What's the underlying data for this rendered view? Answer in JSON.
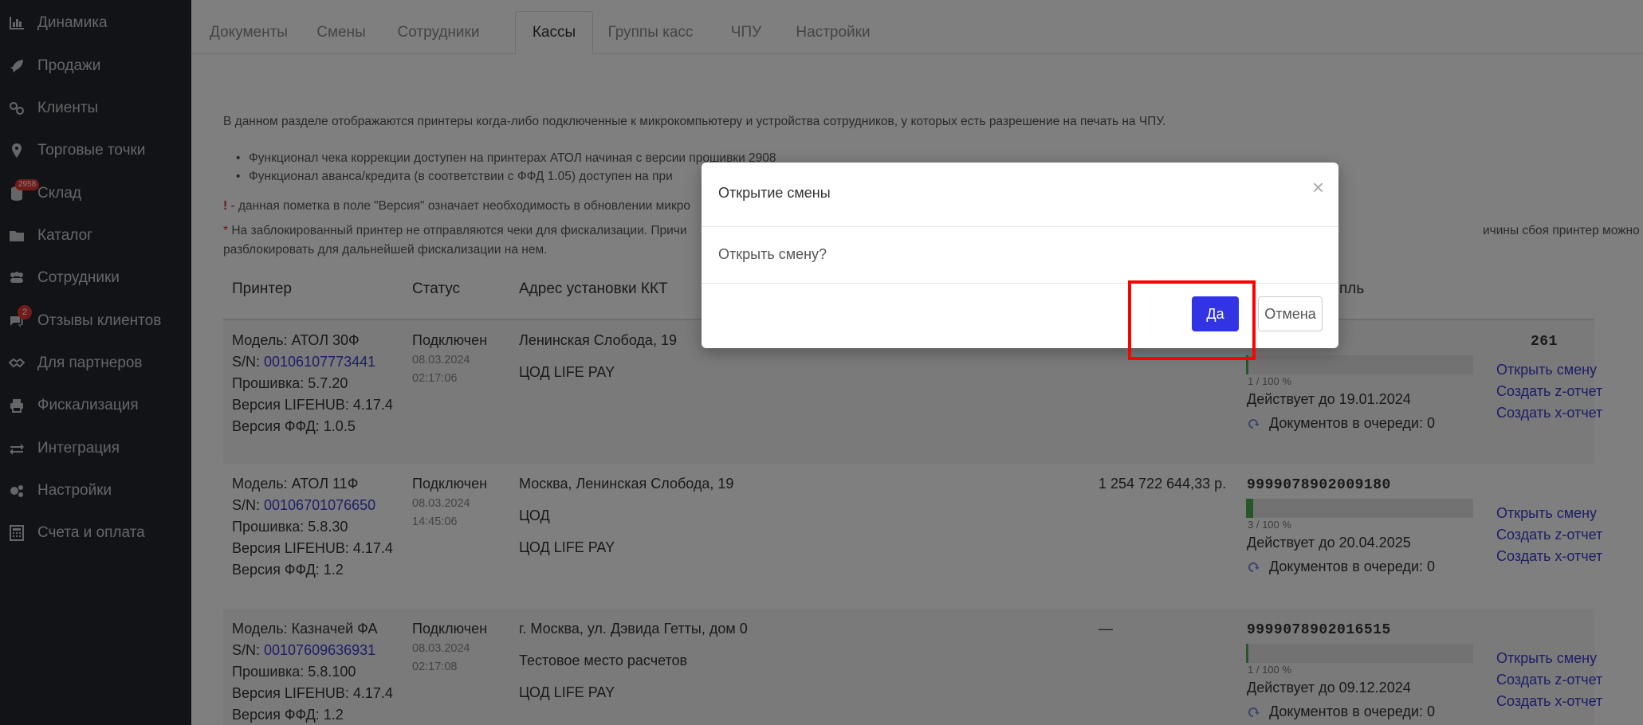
{
  "sidebar": {
    "items": [
      {
        "label": "Динамика",
        "icon": "bar-chart-icon"
      },
      {
        "label": "Продажи",
        "icon": "rocket-icon"
      },
      {
        "label": "Клиенты",
        "icon": "handshake-icon"
      },
      {
        "label": "Торговые точки",
        "icon": "map-pin-icon"
      },
      {
        "label": "Склад",
        "icon": "database-icon",
        "badge": "2958"
      },
      {
        "label": "Каталог",
        "icon": "folder-icon"
      },
      {
        "label": "Сотрудники",
        "icon": "users-icon"
      },
      {
        "label": "Отзывы клиентов",
        "icon": "comments-icon",
        "badge": "2"
      },
      {
        "label": "Для партнеров",
        "icon": "handshake-icon"
      },
      {
        "label": "Фискализация",
        "icon": "printer-icon"
      },
      {
        "label": "Интеграция",
        "icon": "exchange-icon"
      },
      {
        "label": "Настройки",
        "icon": "gears-icon"
      },
      {
        "label": "Счета и оплата",
        "icon": "calculator-icon"
      }
    ]
  },
  "tabs": [
    "Документы",
    "Смены",
    "Сотрудники",
    "Кассы",
    "Группы касс",
    "ЧПУ",
    "Настройки"
  ],
  "active_tab": "Кассы",
  "info": {
    "intro": "В данном разделе отображаются принтеры когда-либо подключенные к микрокомпьютеру и устройства сотрудников, у которых есть разрешение на печать на ЧПУ.",
    "bullet1": "Функционал чека коррекции доступен на принтерах АТОЛ начиная с версии прошивки 2908",
    "bullet2": "Функционал аванса/кредита (в соответствии с ФФД 1.05) доступен на при",
    "note_mark": "!",
    "note_version": " - данная пометка в поле \"Версия\" означает необходимость в обновлении микро",
    "note_star": "*",
    "note_blocked": " На заблокированный принтер не отправляются чеки для фискализации. Причи",
    "note_blocked_tail": "ичины сбоя принтер можно",
    "note_blocked_line2": "разблокировать для дальнейшей фискализации на нем."
  },
  "table": {
    "headers": {
      "printer": "Принтер",
      "status": "Статус",
      "address": "Адрес установки ККТ",
      "storage": "пль"
    },
    "rows": [
      {
        "model": "Модель: АТОЛ 30Ф",
        "sn_label": "S/N: ",
        "sn": "00106107773441",
        "firmware": "Прошивка: 5.7.20",
        "lifehub": "Версия LIFEHUB: 4.17.4",
        "ffd": "Версия ФФД: 1.0.5",
        "status": "Подключен",
        "status_date": "08.03.2024",
        "status_time": "02:17:06",
        "address_lines": [
          "Ленинская Слобода, 19",
          "ЦОД LIFE PAY"
        ],
        "amount": "",
        "fn_number": "261",
        "fn_progress": "1 / 100 %",
        "fn_fill": 0.01,
        "valid_until": "Действует до 19.01.2024",
        "queue": "Документов в очереди: 0",
        "actions": [
          "Открыть смену",
          "Создать z-отчет",
          "Создать x-отчет"
        ]
      },
      {
        "model": "Модель: АТОЛ 11Ф",
        "sn_label": "S/N: ",
        "sn": "00106701076650",
        "firmware": "Прошивка: 5.8.30",
        "lifehub": "Версия LIFEHUB: 4.17.4",
        "ffd": "Версия ФФД: 1.2",
        "status": "Подключен",
        "status_date": "08.03.2024",
        "status_time": "14:45:06",
        "address_lines": [
          "Москва, Ленинская Слобода, 19",
          "ЦОД",
          "ЦОД LIFE PAY"
        ],
        "amount": "1 254 722 644,33 р.",
        "fn_number": "9999078902009180",
        "fn_progress": "3 / 100 %",
        "fn_fill": 0.03,
        "valid_until": "Действует до 20.04.2025",
        "queue": "Документов в очереди: 0",
        "actions": [
          "Открыть смену",
          "Создать z-отчет",
          "Создать x-отчет"
        ]
      },
      {
        "model": "Модель: Казначей ФА",
        "sn_label": "S/N: ",
        "sn": "00107609636931",
        "firmware": "Прошивка: 5.8.100",
        "lifehub": "Версия LIFEHUB: 4.17.4",
        "ffd": "Версия ФФД: 1.2",
        "status": "Подключен",
        "status_date": "08.03.2024",
        "status_time": "02:17:08",
        "address_lines": [
          "г. Москва, ул. Дэвида Гетты, дом 0",
          "Тестовое место расчетов",
          "ЦОД LIFE PAY"
        ],
        "amount": "—",
        "fn_number": "9999078902016515",
        "fn_progress": "1 / 100 %",
        "fn_fill": 0.01,
        "valid_until": "Действует до 09.12.2024",
        "queue": "Документов в очереди: 0",
        "actions": [
          "Открыть смену",
          "Создать z-отчет",
          "Создать x-отчет"
        ]
      }
    ]
  },
  "modal": {
    "title": "Открытие смены",
    "close": "×",
    "question": "Открыть смену?",
    "yes": "Да",
    "cancel": "Отмена"
  },
  "colors": {
    "accent": "#3333e6",
    "highlight": "#ff0000",
    "sidebar_bg": "#23272e",
    "link": "#3a3acf"
  }
}
